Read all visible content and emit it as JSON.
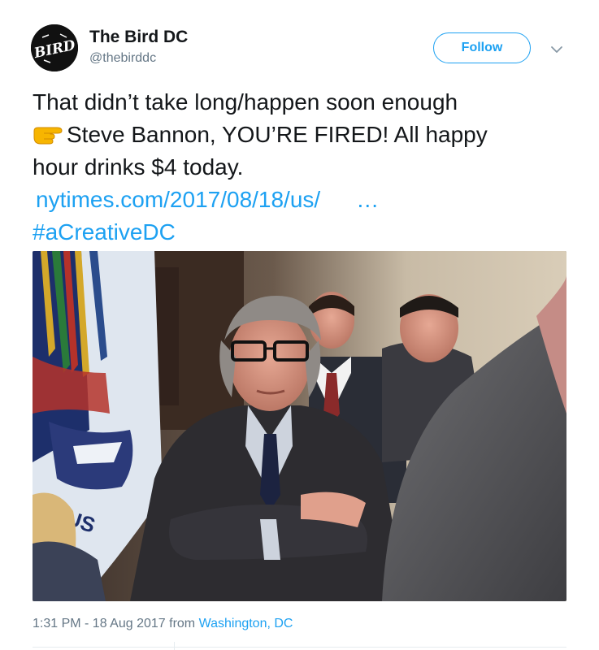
{
  "account": {
    "name": "The Bird DC",
    "handle": "@thebirddc",
    "avatar_logo_text": "BIRD"
  },
  "actions": {
    "follow_label": "Follow",
    "more_icon": "chevron-down-icon"
  },
  "tweet": {
    "line1": "That didn’t take long/happen soon enough",
    "line2_emoji": "backhand-index-pointing-right",
    "line2": "Steve Bannon, YOU’RE FIRED! All happy",
    "line3": "hour drinks $4 today.",
    "link_text": "nytimes.com/2017/08/18/us/",
    "link_ellipsis": "…",
    "hashtag": "#aCreativeDC"
  },
  "photo": {
    "flag_lettering": "US"
  },
  "footer": {
    "time_date": "1:31 PM - 18 Aug 2017 from",
    "location": "Washington, DC"
  },
  "colors": {
    "accent": "#1da1f2",
    "text": "#14171a",
    "muted": "#657786"
  }
}
